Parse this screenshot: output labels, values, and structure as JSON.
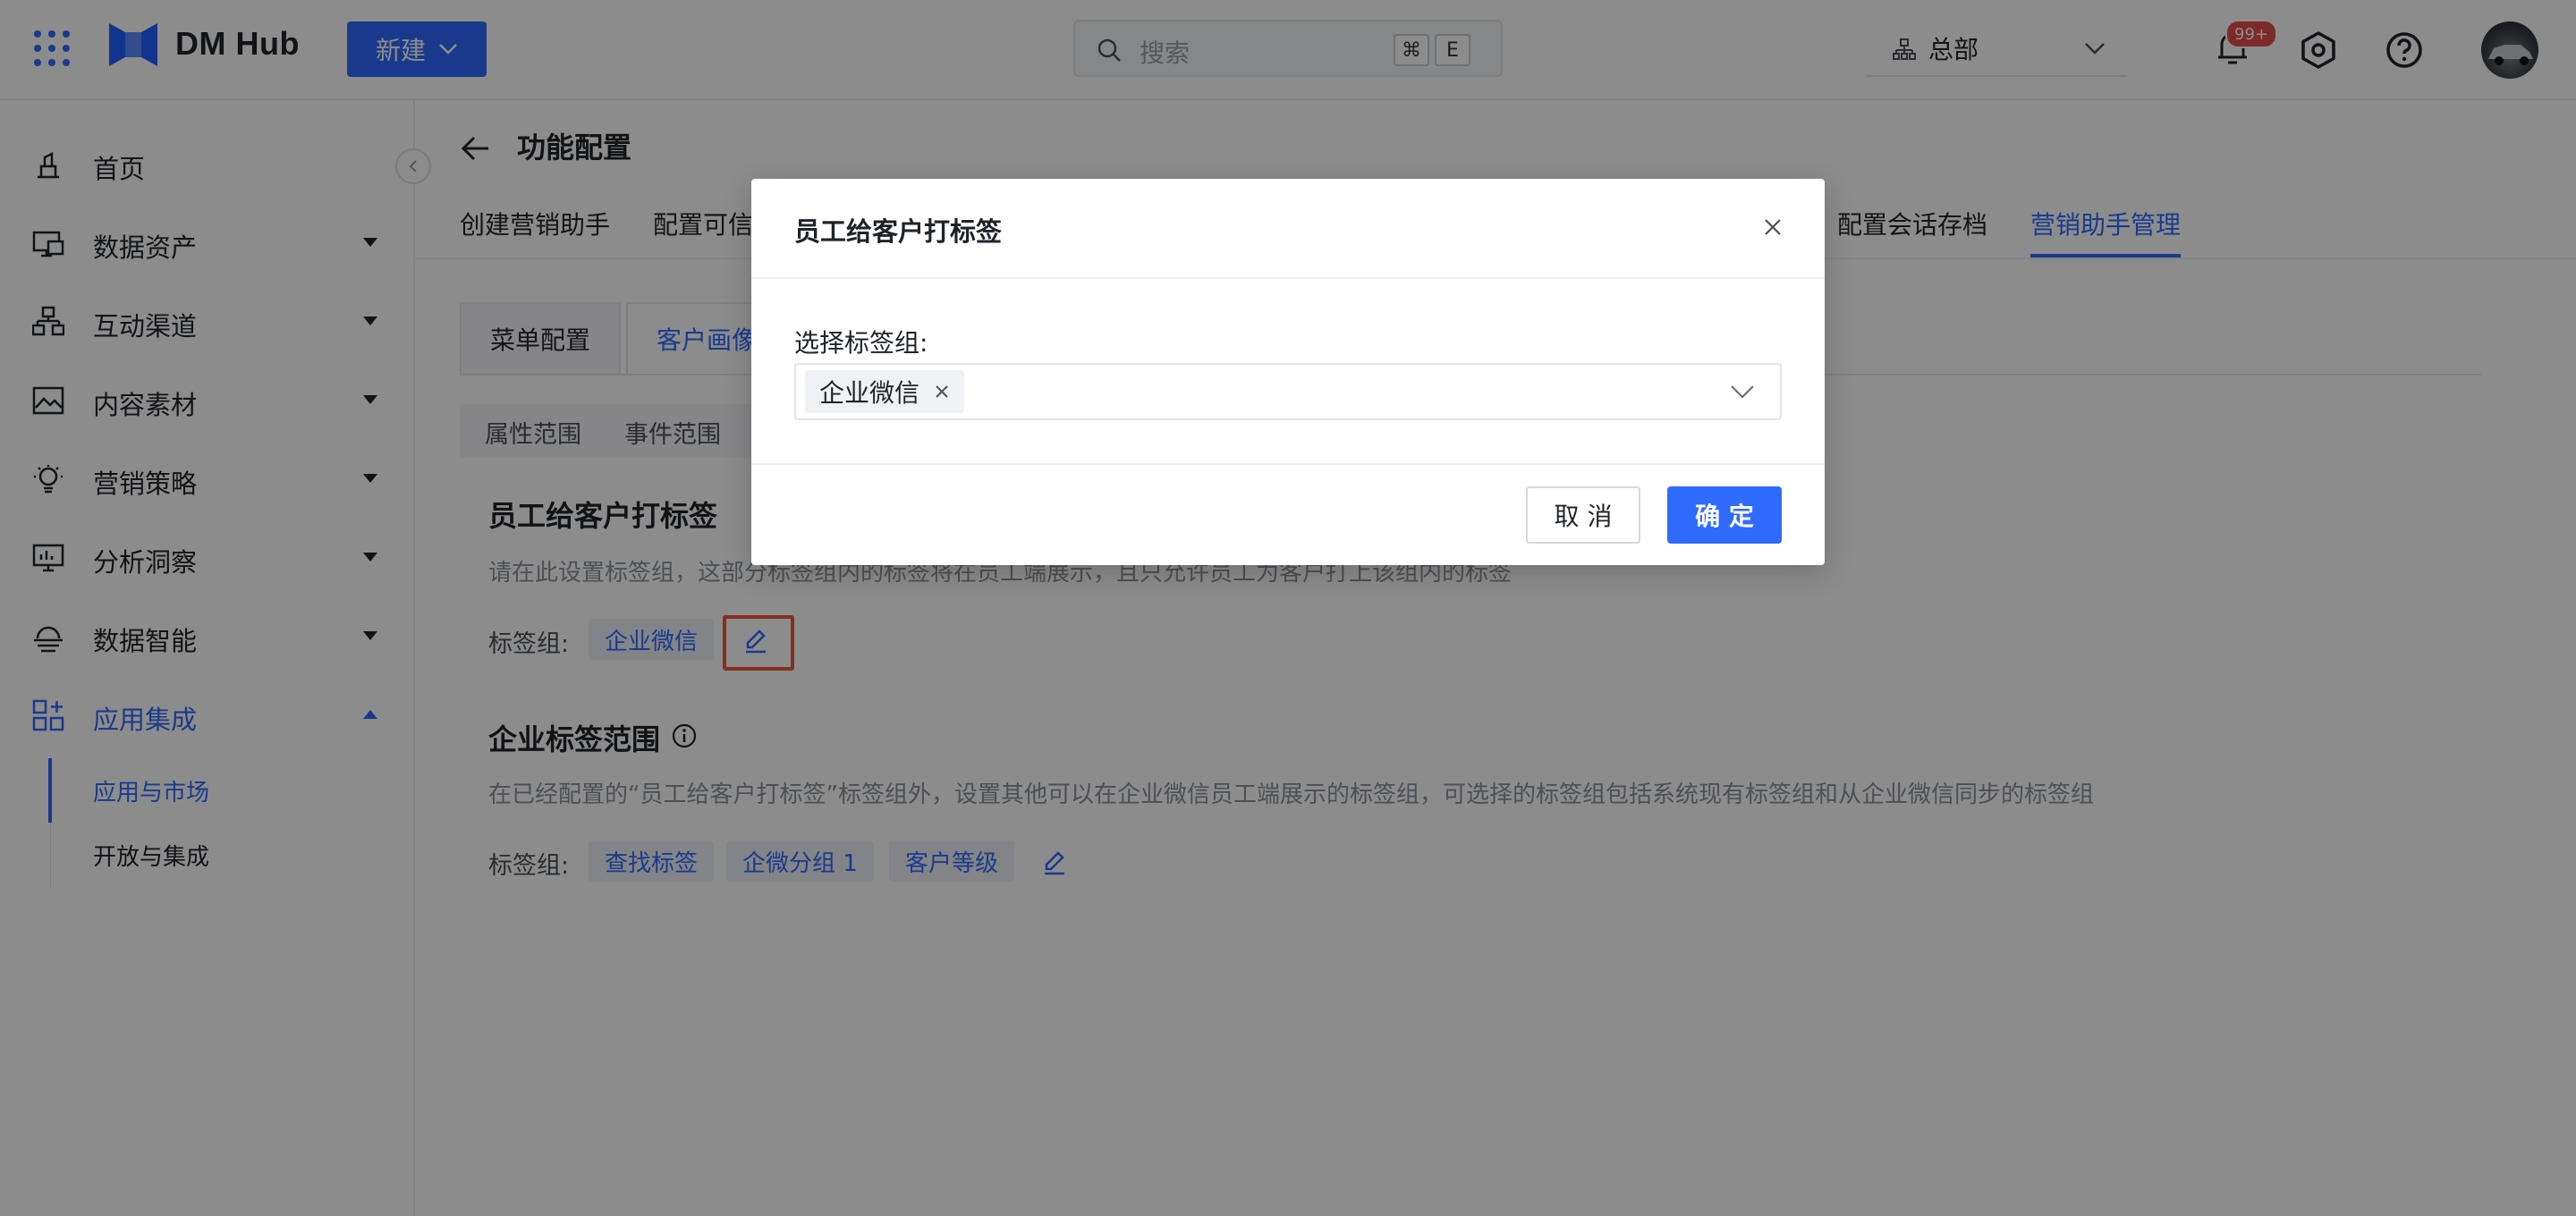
{
  "header": {
    "app_name": "DM Hub",
    "new_button_label": "新建",
    "search_placeholder": "搜索",
    "shortcut_cmd": "⌘",
    "shortcut_key": "E",
    "org_label": "总部",
    "notification_badge": "99+",
    "icons": [
      "apps-grid-icon",
      "logo-icon",
      "search-icon",
      "org-icon",
      "bell-icon",
      "settings-hex-icon",
      "help-icon",
      "avatar"
    ]
  },
  "sidebar": {
    "items": [
      {
        "label": "首页",
        "icon": "home-icon"
      },
      {
        "label": "数据资产",
        "icon": "data-assets-icon"
      },
      {
        "label": "互动渠道",
        "icon": "channels-icon"
      },
      {
        "label": "内容素材",
        "icon": "content-icon"
      },
      {
        "label": "营销策略",
        "icon": "strategy-icon"
      },
      {
        "label": "分析洞察",
        "icon": "analytics-icon"
      },
      {
        "label": "数据智能",
        "icon": "data-intel-icon"
      },
      {
        "label": "应用集成",
        "icon": "app-integration-icon",
        "active": true
      }
    ],
    "sub_items": [
      {
        "label": "应用与市场",
        "active": true
      },
      {
        "label": "开放与集成"
      }
    ]
  },
  "main": {
    "title": "功能配置",
    "tabs": [
      "创建营销助手",
      "配置可信",
      "配置会话存档",
      "营销助手管理"
    ],
    "active_tab": "营销助手管理",
    "card_tabs": [
      "菜单配置",
      "客户画像"
    ],
    "segments": [
      "属性范围",
      "事件范围"
    ],
    "section1": {
      "title": "员工给客户打标签",
      "desc": "请在此设置标签组，这部分标签组内的标签将在员工端展示，且只允许员工为客户打上该组内的标签",
      "tag_label": "标签组:",
      "tags": [
        "企业微信"
      ]
    },
    "section2": {
      "title": "企业标签范围",
      "desc": "在已经配置的“员工给客户打标签”标签组外，设置其他可以在企业微信员工端展示的标签组，可选择的标签组包括系统现有标签组和从企业微信同步的标签组",
      "tag_label": "标签组:",
      "tags": [
        "查找标签",
        "企微分组 1",
        "客户等级"
      ]
    }
  },
  "modal": {
    "title": "员工给客户打标签",
    "field_label": "选择标签组:",
    "selected": [
      "企业微信"
    ],
    "cancel_label": "取 消",
    "ok_label": "确 定"
  },
  "colors": {
    "primary": "#2f6bff",
    "highlight": "#f0563a",
    "badge": "#e34d4d"
  }
}
